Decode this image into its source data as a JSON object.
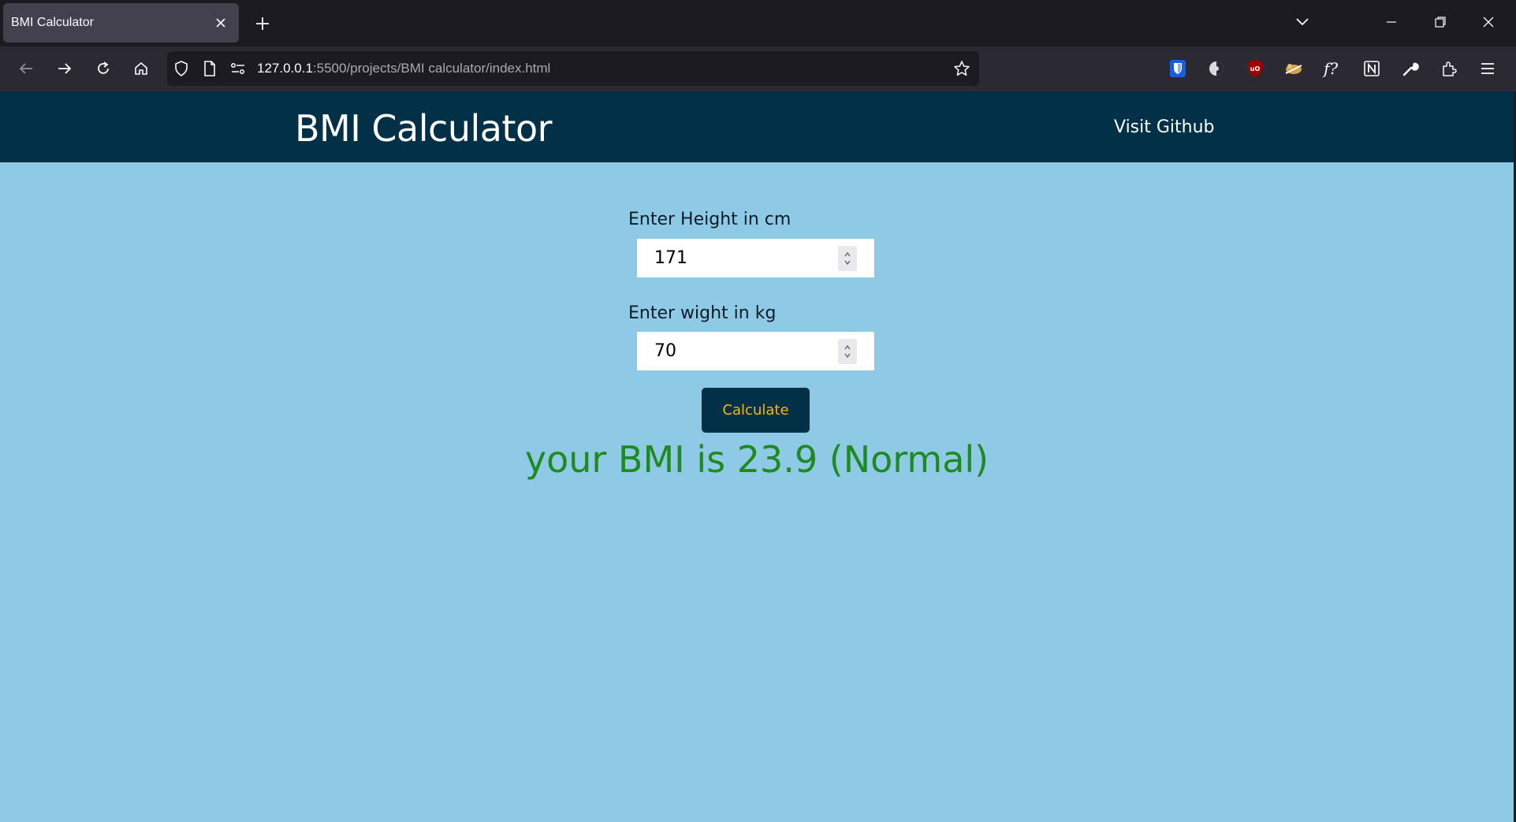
{
  "browser": {
    "tab": {
      "title": "BMI Calculator"
    },
    "url": {
      "host": "127.0.0.1",
      "rest": ":5500/projects/BMI calculator/index.html"
    }
  },
  "header": {
    "title": "BMI Calculator",
    "link_label": "Visit Github"
  },
  "form": {
    "height_label": "Enter Height in cm",
    "height_value": "171",
    "weight_label": "Enter wight in kg",
    "weight_value": "70",
    "button_label": "Calculate"
  },
  "result": {
    "text": "your BMI is 23.9 (Normal)"
  },
  "colors": {
    "header_bg": "#023047",
    "page_bg": "#8ecae6",
    "button_text": "#ffb703",
    "result_text": "#1f8a1f"
  }
}
